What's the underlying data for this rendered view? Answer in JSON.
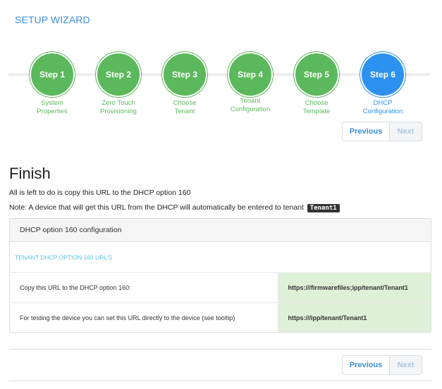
{
  "wizard": {
    "title": "SETUP WIZARD"
  },
  "steps": [
    {
      "label": "Step 1",
      "caption": "System\nProperties",
      "status": "complete"
    },
    {
      "label": "Step 2",
      "caption": "Zero Touch\nProvisioning",
      "status": "complete"
    },
    {
      "label": "Step 3",
      "caption": "Choose\nTenant",
      "status": "complete"
    },
    {
      "label": "Step 4",
      "caption": "Tenant\nConfiguration",
      "status": "complete"
    },
    {
      "label": "Step 5",
      "caption": "Choose\nTemplate",
      "status": "complete"
    },
    {
      "label": "Step 6",
      "caption": "DHCP\nConfiguration",
      "status": "active"
    }
  ],
  "nav": {
    "previous_label": "Previous",
    "next_label": "Next"
  },
  "finish": {
    "title": "Finish",
    "instruction": "All is left to do is copy this URL to the DHCP option 160",
    "note_prefix": "Note: A device that will get this URL from the DHCP will automatically be entered to tenant",
    "tenant": "Tenant1"
  },
  "panel": {
    "heading": "DHCP option 160 configuration",
    "section_title": "TENANT DHCP OPTION 160 URL'S",
    "rows": [
      {
        "description": "Copy this URL to the DHCP option 160:",
        "url": "https:///firmwarefiles;ipp/tenant/Tenant1"
      },
      {
        "description": "For testing the device you can set this URL directly to the device (see tooltip)",
        "url": "https:///ipp/tenant/Tenant1"
      }
    ]
  },
  "colors": {
    "complete": "#5cb85c",
    "active": "#2d91ef",
    "link": "#3d8fd6",
    "url_cell": "#dff0d8"
  }
}
